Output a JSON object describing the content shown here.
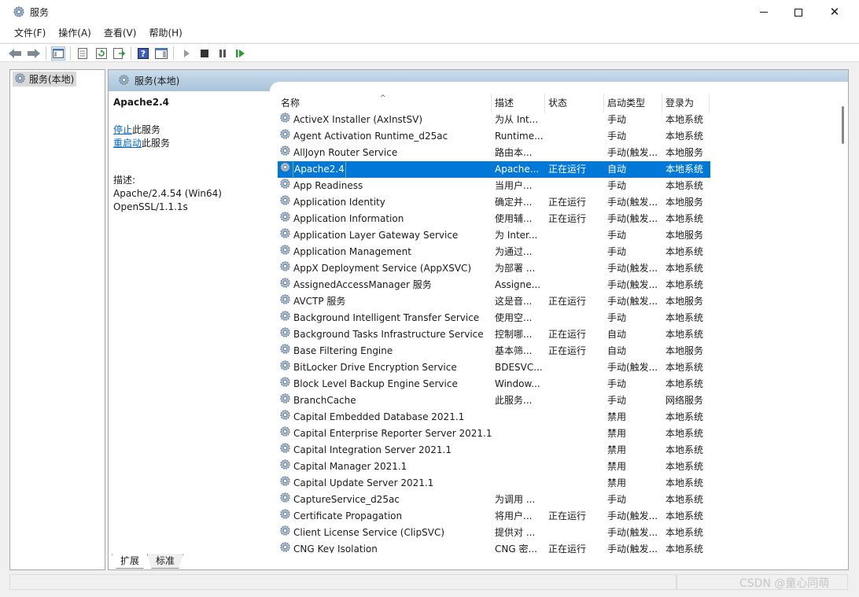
{
  "window": {
    "title": "服务",
    "icon": "gear-icon"
  },
  "menu": [
    "文件(F)",
    "操作(A)",
    "查看(V)",
    "帮助(H)"
  ],
  "toolbar": {
    "buttons": [
      "back-arrow-icon",
      "forward-arrow-icon",
      "show-hide-console-tree-icon",
      "properties-icon",
      "refresh-icon",
      "export-list-icon",
      "help-icon",
      "show-hide-action-pane-icon",
      "start-service-icon",
      "stop-service-icon",
      "pause-service-icon",
      "restart-service-icon"
    ]
  },
  "tree": {
    "item_label": "服务(本地)"
  },
  "content": {
    "header_label": "服务(本地)"
  },
  "detail": {
    "service_name": "Apache2.4",
    "stop_link": "停止",
    "stop_suffix": "此服务",
    "restart_link": "重启动",
    "restart_suffix": "此服务",
    "desc_label": "描述:",
    "desc_line1": "Apache/2.4.54 (Win64)",
    "desc_line2": "OpenSSL/1.1.1s"
  },
  "columns": {
    "name": "名称",
    "desc": "描述",
    "status": "状态",
    "start_type": "启动类型",
    "logon": "登录为"
  },
  "services": [
    {
      "name": "ActiveX Installer (AxInstSV)",
      "desc": "为从 Int...",
      "status": "",
      "start": "手动",
      "logon": "本地系统"
    },
    {
      "name": "Agent Activation Runtime_d25ac",
      "desc": "Runtime...",
      "status": "",
      "start": "手动",
      "logon": "本地系统"
    },
    {
      "name": "AllJoyn Router Service",
      "desc": "路由本...",
      "status": "",
      "start": "手动(触发...",
      "logon": "本地服务"
    },
    {
      "name": "Apache2.4",
      "desc": "Apache...",
      "status": "正在运行",
      "start": "自动",
      "logon": "本地系统",
      "selected": true
    },
    {
      "name": "App Readiness",
      "desc": "当用户...",
      "status": "",
      "start": "手动",
      "logon": "本地系统"
    },
    {
      "name": "Application Identity",
      "desc": "确定并...",
      "status": "正在运行",
      "start": "手动(触发...",
      "logon": "本地服务"
    },
    {
      "name": "Application Information",
      "desc": "使用辅...",
      "status": "正在运行",
      "start": "手动(触发...",
      "logon": "本地系统"
    },
    {
      "name": "Application Layer Gateway Service",
      "desc": "为 Inter...",
      "status": "",
      "start": "手动",
      "logon": "本地服务"
    },
    {
      "name": "Application Management",
      "desc": "为通过...",
      "status": "",
      "start": "手动",
      "logon": "本地系统"
    },
    {
      "name": "AppX Deployment Service (AppXSVC)",
      "desc": "为部署 ...",
      "status": "",
      "start": "手动(触发...",
      "logon": "本地系统"
    },
    {
      "name": "AssignedAccessManager 服务",
      "desc": "Assigne...",
      "status": "",
      "start": "手动(触发...",
      "logon": "本地系统"
    },
    {
      "name": "AVCTP 服务",
      "desc": "这是音...",
      "status": "正在运行",
      "start": "手动(触发...",
      "logon": "本地服务"
    },
    {
      "name": "Background Intelligent Transfer Service",
      "desc": "使用空...",
      "status": "",
      "start": "手动",
      "logon": "本地系统"
    },
    {
      "name": "Background Tasks Infrastructure Service",
      "desc": "控制哪...",
      "status": "正在运行",
      "start": "自动",
      "logon": "本地系统"
    },
    {
      "name": "Base Filtering Engine",
      "desc": "基本筛...",
      "status": "正在运行",
      "start": "自动",
      "logon": "本地服务"
    },
    {
      "name": "BitLocker Drive Encryption Service",
      "desc": "BDESVC...",
      "status": "",
      "start": "手动(触发...",
      "logon": "本地系统"
    },
    {
      "name": "Block Level Backup Engine Service",
      "desc": "Window...",
      "status": "",
      "start": "手动",
      "logon": "本地系统"
    },
    {
      "name": "BranchCache",
      "desc": "此服务...",
      "status": "",
      "start": "手动",
      "logon": "网络服务"
    },
    {
      "name": "Capital Embedded Database 2021.1",
      "desc": "",
      "status": "",
      "start": "禁用",
      "logon": "本地系统"
    },
    {
      "name": "Capital Enterprise Reporter Server 2021.1",
      "desc": "",
      "status": "",
      "start": "禁用",
      "logon": "本地系统"
    },
    {
      "name": "Capital Integration Server 2021.1",
      "desc": "",
      "status": "",
      "start": "禁用",
      "logon": "本地系统"
    },
    {
      "name": "Capital Manager 2021.1",
      "desc": "",
      "status": "",
      "start": "禁用",
      "logon": "本地系统"
    },
    {
      "name": "Capital Update Server 2021.1",
      "desc": "",
      "status": "",
      "start": "禁用",
      "logon": "本地系统"
    },
    {
      "name": "CaptureService_d25ac",
      "desc": "为调用 ...",
      "status": "",
      "start": "手动",
      "logon": "本地系统"
    },
    {
      "name": "Certificate Propagation",
      "desc": "将用户...",
      "status": "正在运行",
      "start": "手动(触发...",
      "logon": "本地系统"
    },
    {
      "name": "Client License Service (ClipSVC)",
      "desc": "提供对 ...",
      "status": "",
      "start": "手动(触发...",
      "logon": "本地系统"
    },
    {
      "name": "CNG Key Isolation",
      "desc": "CNG 密...",
      "status": "正在运行",
      "start": "手动(触发...",
      "logon": "本地系统"
    }
  ],
  "tabs": [
    "扩展",
    "标准"
  ],
  "watermark": "CSDN @童心同萌"
}
